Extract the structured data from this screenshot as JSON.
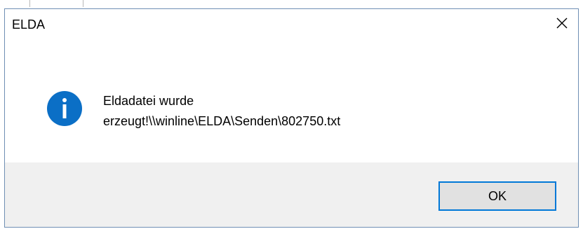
{
  "dialog": {
    "title": "ELDA",
    "message_line1": "Eldadatei wurde",
    "message_line2": "erzeugt!\\\\winline\\ELDA\\Senden\\802750.txt",
    "ok_label": "OK",
    "icon": "info-icon",
    "close_icon": "close-icon"
  },
  "colors": {
    "info_icon": "#0b6fc6",
    "button_border": "#0078d7",
    "footer_bg": "#f0f0f0",
    "window_border": "#6f8fb4"
  }
}
